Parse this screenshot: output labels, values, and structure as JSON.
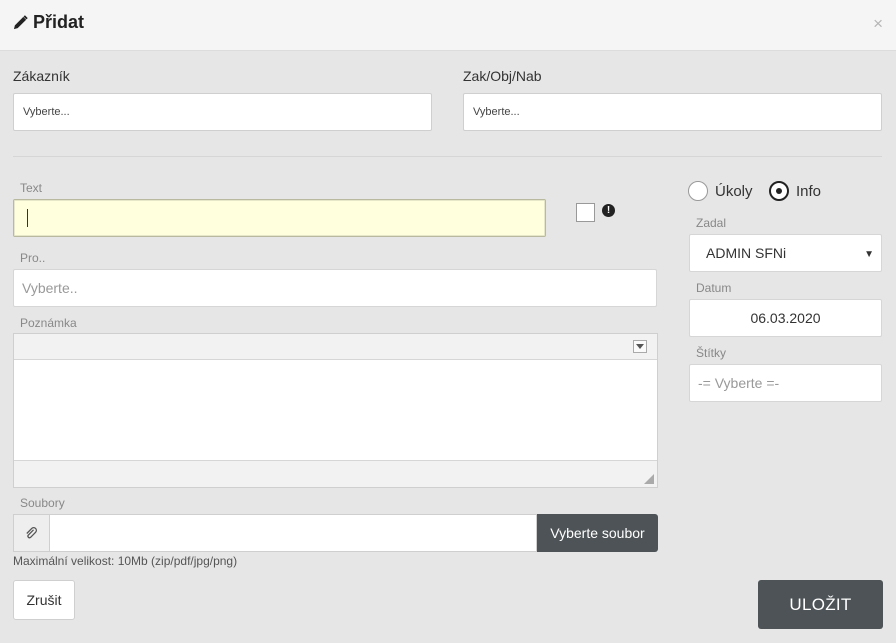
{
  "header": {
    "title": "Přidat",
    "close": "×"
  },
  "customer": {
    "label": "Zákazník",
    "placeholder": "Vyberte..."
  },
  "order": {
    "label": "Zak/Obj/Nab",
    "placeholder": "Vyberte..."
  },
  "text_field": {
    "label": "Text",
    "value": ""
  },
  "for_field": {
    "label": "Pro..",
    "placeholder": "Vyberte.."
  },
  "note": {
    "label": "Poznámka"
  },
  "files": {
    "label": "Soubory",
    "browse_label": "Vyberte soubor",
    "hint": "Maximální velikost: 10Mb (zip/pdf/jpg/png)"
  },
  "mode": {
    "options": [
      "Úkoly",
      "Info"
    ],
    "selected": "Info"
  },
  "assigned_by": {
    "label": "Zadal",
    "value": "ADMIN SFNi"
  },
  "date": {
    "label": "Datum",
    "value": "06.03.2020"
  },
  "tags": {
    "label": "Štítky",
    "placeholder": "-= Vyberte =-"
  },
  "actions": {
    "cancel": "Zrušit",
    "save": "ULOŽIT"
  },
  "colors": {
    "dark_button": "#4d5356",
    "text_highlight": "#ffffdd",
    "background": "#e6e6e6"
  }
}
